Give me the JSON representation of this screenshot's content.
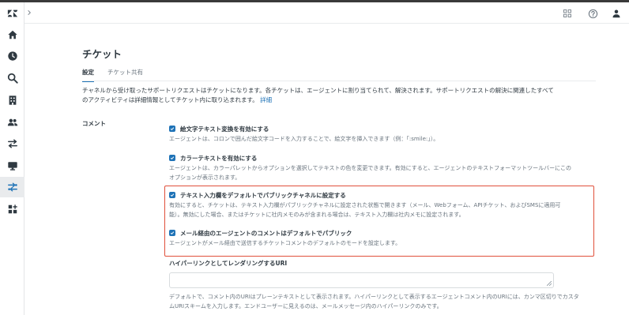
{
  "colors": {
    "accent": "#1f73b7",
    "highlight": "#e0503b",
    "text": "#2f3941",
    "muted": "#68737d"
  },
  "sidebar": {
    "items": [
      {
        "name": "logo-icon",
        "icon": "zendesk-logo"
      },
      {
        "name": "home-icon",
        "icon": "home"
      },
      {
        "name": "clock-icon",
        "icon": "clock"
      },
      {
        "name": "search-icon",
        "icon": "search"
      },
      {
        "name": "building-icon",
        "icon": "building"
      },
      {
        "name": "people-icon",
        "icon": "people"
      },
      {
        "name": "transfer-icon",
        "icon": "arrows"
      },
      {
        "name": "monitor-icon",
        "icon": "monitor"
      },
      {
        "name": "objects-icon",
        "icon": "objects",
        "active": true
      },
      {
        "name": "apps-icon",
        "icon": "apps-plus"
      }
    ]
  },
  "topbar": {
    "icons": [
      "grid-icon",
      "help-icon",
      "user-icon"
    ]
  },
  "page": {
    "title": "チケット",
    "tabs": [
      {
        "label": "設定",
        "active": true
      },
      {
        "label": "チケット共有",
        "active": false
      }
    ],
    "description": "チャネルから受け取ったサポートリクエストはチケットになります。各チケットは、エージェントに割り当てられて、解決されます。サポートリクエストの解決に関連したすべてのアクティビティは詳細情報としてチケット内に取り込まれます。",
    "description_link": "詳細"
  },
  "comment_section": {
    "label": "コメント",
    "options": [
      {
        "title": "絵文字テキスト変換を有効にする",
        "checked": true,
        "text": "エージェントは、コロンで囲んだ絵文字コードを入力することで、絵文字を挿入できます（例：「:smile:」）。"
      },
      {
        "title": "カラーテキストを有効にする",
        "checked": true,
        "text": "エージェントは、カラーパレットからオプションを選択してテキストの色を変更できます。有効にすると、エージェントのテキストフォーマットツールバーにこのオプションが表示されます。"
      },
      {
        "title": "テキスト入力欄をデフォルトでパブリックチャネルに設定する",
        "checked": true,
        "text": "有効にすると、チケットは、テキスト入力欄がパブリックチャネルに設定された状態で開きます（メール、Webフォーム、APIチケット、およびSMSに適用可能）。無効にした場合、またはチケットに社内メモのみが含まれる場合は、テキスト入力欄は社内メモに設定されます。"
      },
      {
        "title": "メール経由のエージェントのコメントはデフォルトでパブリック",
        "checked": true,
        "text": "エージェントがメール経由で送信するチケットコメントのデフォルトのモードを設定します。"
      }
    ],
    "uri_field": {
      "label": "ハイパーリンクとしてレンダリングするURI",
      "value": "",
      "help": "デフォルトで、コメント内のURIはプレーンテキストとして表示されます。ハイパーリンクとして表示するエージェントコメント内のURIには、カンマ区切りでカスタムURIスキームを入力します。エンドユーザーに見えるのは、メールメッセージ内のハイパーリンクのみです。"
    }
  }
}
